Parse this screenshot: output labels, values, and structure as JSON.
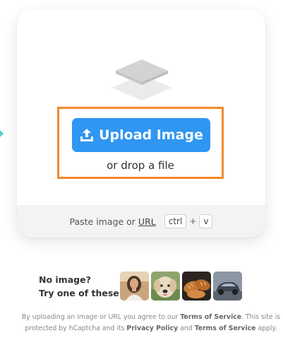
{
  "upload": {
    "button_label": "Upload Image",
    "drop_text": "or drop a file"
  },
  "paste": {
    "prefix": "Paste image or",
    "url_link": "URL",
    "key_ctrl": "ctrl",
    "plus": "+",
    "key_v": "v"
  },
  "samples": {
    "line1": "No image?",
    "line2": "Try one of these:",
    "thumbnails": [
      "woman-photo",
      "dog-photo",
      "bread-photo",
      "car-photo"
    ]
  },
  "legal": {
    "t1": "By uploading an image or URL you agree to our",
    "terms": "Terms of Service",
    "t2": ". This site is protected by hCaptcha and its",
    "privacy": "Privacy Policy",
    "t3": "and",
    "terms2": "Terms of Service",
    "t4": "apply."
  },
  "colors": {
    "accent_blue": "#2f96f1",
    "highlight_orange": "#f28a2c",
    "teal_marker": "#4fd1c5"
  }
}
